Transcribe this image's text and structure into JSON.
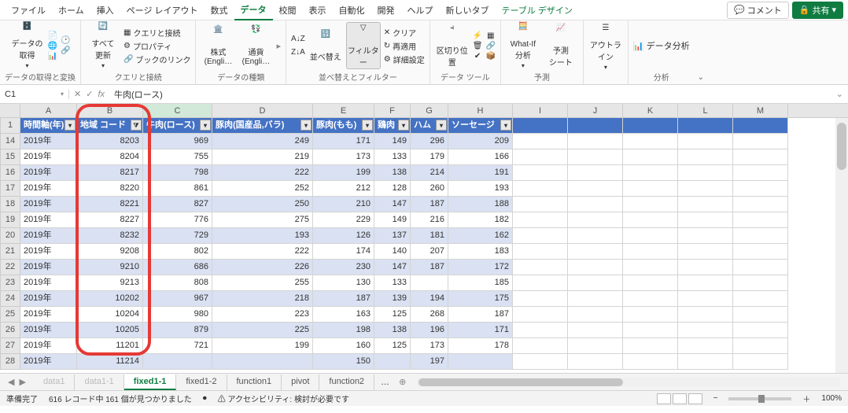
{
  "menu": {
    "items": [
      "ファイル",
      "ホーム",
      "挿入",
      "ページ レイアウト",
      "数式",
      "データ",
      "校閲",
      "表示",
      "自動化",
      "開発",
      "ヘルプ",
      "新しいタブ",
      "テーブル デザイン"
    ],
    "active": 5,
    "comment": "コメント",
    "share": "共有"
  },
  "ribbon": {
    "g1": {
      "btn": "データの\n取得",
      "lbl": "データの取得と変換"
    },
    "g2": {
      "btn": "すべて\n更新",
      "r1": "クエリと接続",
      "r2": "プロパティ",
      "r3": "ブックのリンク",
      "lbl": "クエリと接続"
    },
    "g3": {
      "b1": "株式 (Engli…",
      "b2": "通貨 (Engli…",
      "lbl": "データの種類"
    },
    "g4": {
      "b1": "並べ替え",
      "b2": "フィルター",
      "r1": "クリア",
      "r2": "再適用",
      "r3": "詳細設定",
      "lbl": "並べ替えとフィルター"
    },
    "g5": {
      "b1": "区切り位置",
      "lbl": "データ ツール"
    },
    "g6": {
      "b1": "What-If 分析",
      "b2": "予測\nシート",
      "lbl": "予測"
    },
    "g7": {
      "b1": "アウトラ\nイン",
      "lbl": ""
    },
    "g8": {
      "r1": "データ分析",
      "lbl": "分析"
    }
  },
  "fbar": {
    "name": "C1",
    "fx": "fx",
    "value": "牛肉(ロース)"
  },
  "cols": [
    "A",
    "B",
    "C",
    "D",
    "E",
    "F",
    "G",
    "H",
    "I",
    "J",
    "K",
    "L",
    "M"
  ],
  "headerRow": {
    "num": "1",
    "cells": [
      "時間軸(年)",
      "地域 コード",
      "牛肉(ロース)",
      "豚肉(国産品,バラ)",
      "豚肉(もも)",
      "鶏肉",
      "ハム",
      "ソーセージ"
    ]
  },
  "rows": [
    {
      "n": 14,
      "c": [
        "2019年",
        "8203",
        "969",
        "249",
        "171",
        "149",
        "296",
        "209"
      ]
    },
    {
      "n": 15,
      "c": [
        "2019年",
        "8204",
        "755",
        "219",
        "173",
        "133",
        "179",
        "166"
      ]
    },
    {
      "n": 16,
      "c": [
        "2019年",
        "8217",
        "798",
        "222",
        "199",
        "138",
        "214",
        "191"
      ]
    },
    {
      "n": 17,
      "c": [
        "2019年",
        "8220",
        "861",
        "252",
        "212",
        "128",
        "260",
        "193"
      ]
    },
    {
      "n": 18,
      "c": [
        "2019年",
        "8221",
        "827",
        "250",
        "210",
        "147",
        "187",
        "188"
      ]
    },
    {
      "n": 19,
      "c": [
        "2019年",
        "8227",
        "776",
        "275",
        "229",
        "149",
        "216",
        "182"
      ]
    },
    {
      "n": 20,
      "c": [
        "2019年",
        "8232",
        "729",
        "193",
        "126",
        "137",
        "181",
        "162"
      ]
    },
    {
      "n": 21,
      "c": [
        "2019年",
        "9208",
        "802",
        "222",
        "174",
        "140",
        "207",
        "183"
      ]
    },
    {
      "n": 22,
      "c": [
        "2019年",
        "9210",
        "686",
        "226",
        "230",
        "147",
        "187",
        "172"
      ]
    },
    {
      "n": 23,
      "c": [
        "2019年",
        "9213",
        "808",
        "255",
        "130",
        "133",
        "",
        "185"
      ]
    },
    {
      "n": 24,
      "c": [
        "2019年",
        "10202",
        "967",
        "218",
        "187",
        "139",
        "194",
        "175"
      ]
    },
    {
      "n": 25,
      "c": [
        "2019年",
        "10204",
        "980",
        "223",
        "163",
        "125",
        "268",
        "187"
      ]
    },
    {
      "n": 26,
      "c": [
        "2019年",
        "10205",
        "879",
        "225",
        "198",
        "138",
        "196",
        "171"
      ]
    },
    {
      "n": 27,
      "c": [
        "2019年",
        "11201",
        "721",
        "199",
        "160",
        "125",
        "173",
        "178"
      ]
    },
    {
      "n": 28,
      "c": [
        "2019年",
        "11214",
        "",
        "",
        "150",
        "",
        "197",
        ""
      ]
    }
  ],
  "sheets": {
    "tabs": [
      "data1",
      "data1-1",
      "fixed1-1",
      "fixed1-2",
      "function1",
      "pivot",
      "function2"
    ],
    "active": 2,
    "more": "…"
  },
  "status": {
    "ready": "準備完了",
    "records": "616 レコード中 161 個が見つかりました",
    "acc": "アクセシビリティ: 検討が必要です",
    "zoom": "100%"
  }
}
